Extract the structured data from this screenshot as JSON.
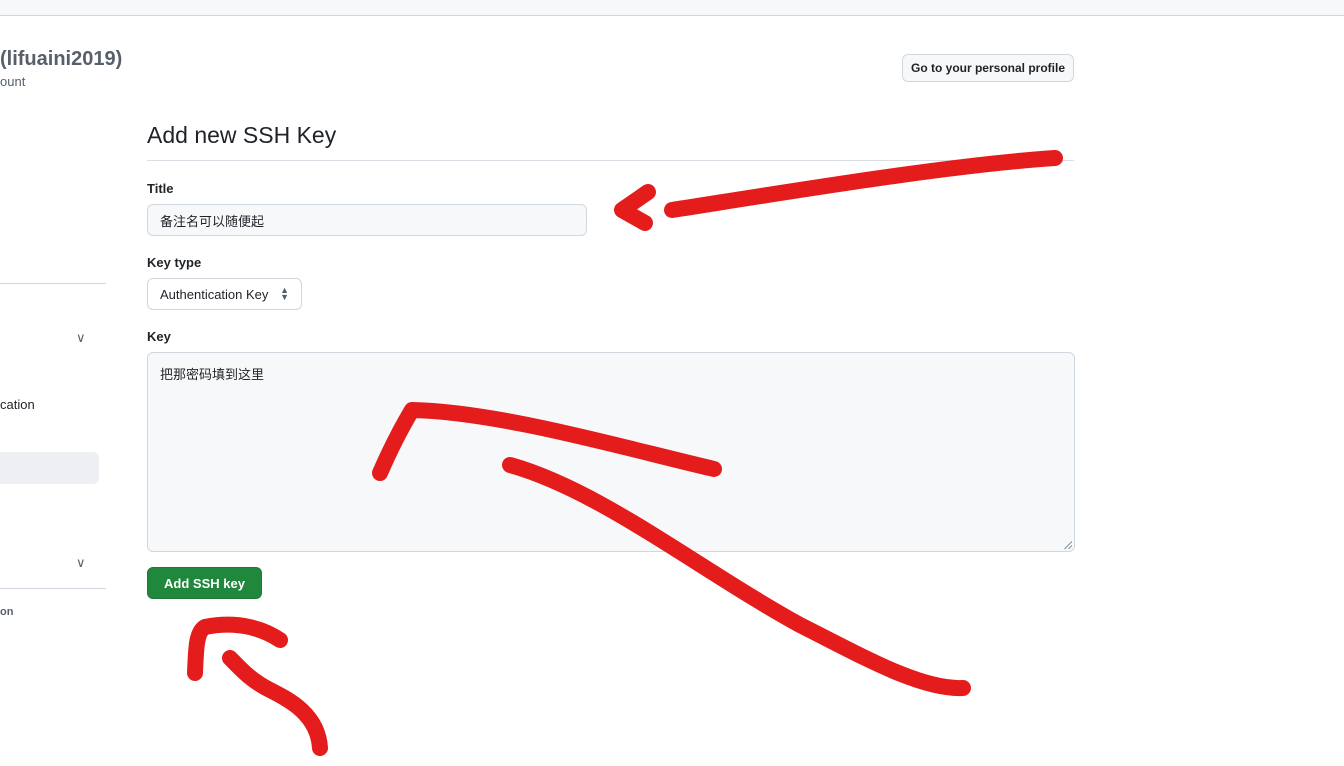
{
  "account": {
    "name": "(lifuaini2019)",
    "subtitle": "ount"
  },
  "header": {
    "profile_button": "Go to your personal profile"
  },
  "sidebar": {
    "partial_item_1": "cation",
    "partial_item_2": "on"
  },
  "form": {
    "heading": "Add new SSH Key",
    "title_label": "Title",
    "title_value": "备注名可以随便起",
    "key_type_label": "Key type",
    "key_type_value": "Authentication Key",
    "key_label": "Key",
    "key_value": "把那密码填到这里",
    "submit_label": "Add SSH key"
  },
  "colors": {
    "primary_button": "#1f883d",
    "annotation": "#e51c1c"
  }
}
